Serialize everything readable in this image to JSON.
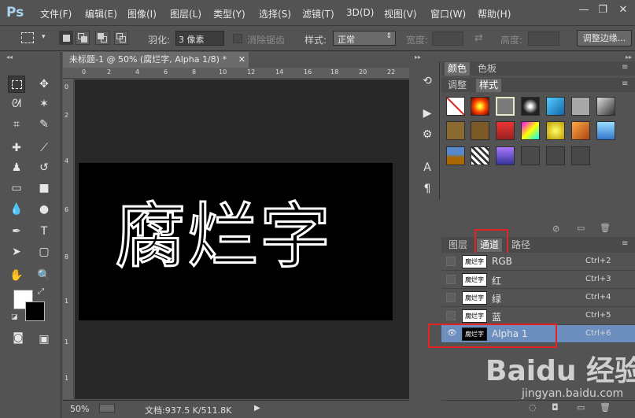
{
  "app": {
    "logo": "Ps"
  },
  "menu": [
    "文件(F)",
    "编辑(E)",
    "图像(I)",
    "图层(L)",
    "类型(Y)",
    "选择(S)",
    "滤镜(T)",
    "3D(D)",
    "视图(V)",
    "窗口(W)",
    "帮助(H)"
  ],
  "window_controls": {
    "minimize": "—",
    "restore": "❐",
    "close": "✕"
  },
  "options": {
    "feather_label": "羽化:",
    "feather_value": "3 像素",
    "antialias_label": "消除锯齿",
    "style_label": "样式:",
    "style_value": "正常",
    "width_label": "宽度:",
    "height_label": "高度:",
    "refine_edge": "调整边缘..."
  },
  "document": {
    "tab_title": "未标题-1 @ 50% (腐烂字, Alpha 1/8) *",
    "canvas_text": "腐烂字",
    "zoom": "50%",
    "doc_size": "文档:937.5 K/511.8K",
    "ruler_h": [
      "0",
      "2",
      "4",
      "6",
      "8",
      "10",
      "12",
      "14",
      "16",
      "18",
      "20",
      "22"
    ],
    "ruler_v": [
      "0",
      "2",
      "4",
      "6",
      "8",
      "1",
      "1",
      "1"
    ]
  },
  "panels": {
    "top_tabs": [
      "颜色",
      "色板"
    ],
    "second_tabs": [
      "调整",
      "样式"
    ],
    "bottom_tabs": [
      "图层",
      "通道",
      "路径"
    ],
    "channels": [
      {
        "name": "RGB",
        "shortcut": "Ctrl+2",
        "thumb": "腐烂字"
      },
      {
        "name": "红",
        "shortcut": "Ctrl+3",
        "thumb": "腐烂字"
      },
      {
        "name": "绿",
        "shortcut": "Ctrl+4",
        "thumb": "腐烂字"
      },
      {
        "name": "蓝",
        "shortcut": "Ctrl+5",
        "thumb": "腐烂字"
      },
      {
        "name": "Alpha 1",
        "shortcut": "Ctrl+6",
        "thumb": "腐烂字"
      }
    ]
  },
  "watermark": {
    "brand": "Baidu 经验",
    "url": "jingyan.baidu.com"
  },
  "colors": {
    "selection": "#6d8fbf",
    "highlight": "#e32424",
    "panel": "#535353"
  }
}
